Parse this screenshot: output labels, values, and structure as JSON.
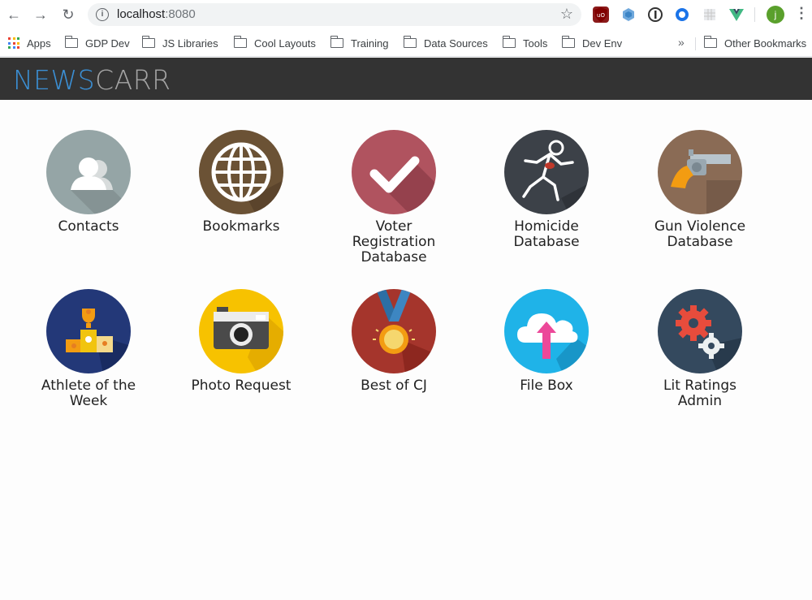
{
  "browser": {
    "url_host": "localhost",
    "url_port": ":8080",
    "profile_initial": "j",
    "extensions": [
      "ublock-origin-icon",
      "extension-hex-icon",
      "onepassword-icon",
      "extension-ring-icon",
      "extension-grid-icon",
      "vue-devtools-icon"
    ]
  },
  "bookmarks_bar": {
    "items": [
      {
        "label": "Apps",
        "icon": "apps-grid-icon"
      },
      {
        "label": "GDP Dev",
        "icon": "folder-icon"
      },
      {
        "label": "JS Libraries",
        "icon": "folder-icon"
      },
      {
        "label": "Cool Layouts",
        "icon": "folder-icon"
      },
      {
        "label": "Training",
        "icon": "folder-icon"
      },
      {
        "label": "Data Sources",
        "icon": "folder-icon"
      },
      {
        "label": "Tools",
        "icon": "folder-icon"
      },
      {
        "label": "Dev Env",
        "icon": "folder-icon"
      }
    ],
    "overflow": "»",
    "other": "Other Bookmarks"
  },
  "app": {
    "logo_part1": "NEWS",
    "logo_part2": "CARR",
    "colors": {
      "header": "#333333",
      "logo_blue": "#3b8fd4",
      "logo_gray": "#a5a5a5"
    }
  },
  "tiles": [
    {
      "label": "Contacts",
      "icon": "contacts-people-icon"
    },
    {
      "label": "Bookmarks",
      "icon": "globe-icon"
    },
    {
      "label": "Voter Registration Database",
      "icon": "checkmark-icon"
    },
    {
      "label": "Homicide Database",
      "icon": "chalk-outline-icon"
    },
    {
      "label": "Gun Violence Database",
      "icon": "revolver-icon"
    },
    {
      "label": "Athlete of the Week",
      "icon": "trophy-podium-icon"
    },
    {
      "label": "Photo Request",
      "icon": "camera-icon"
    },
    {
      "label": "Best of CJ",
      "icon": "medal-icon"
    },
    {
      "label": "File Box",
      "icon": "cloud-upload-icon"
    },
    {
      "label": "Lit Ratings Admin",
      "icon": "gears-icon"
    }
  ]
}
